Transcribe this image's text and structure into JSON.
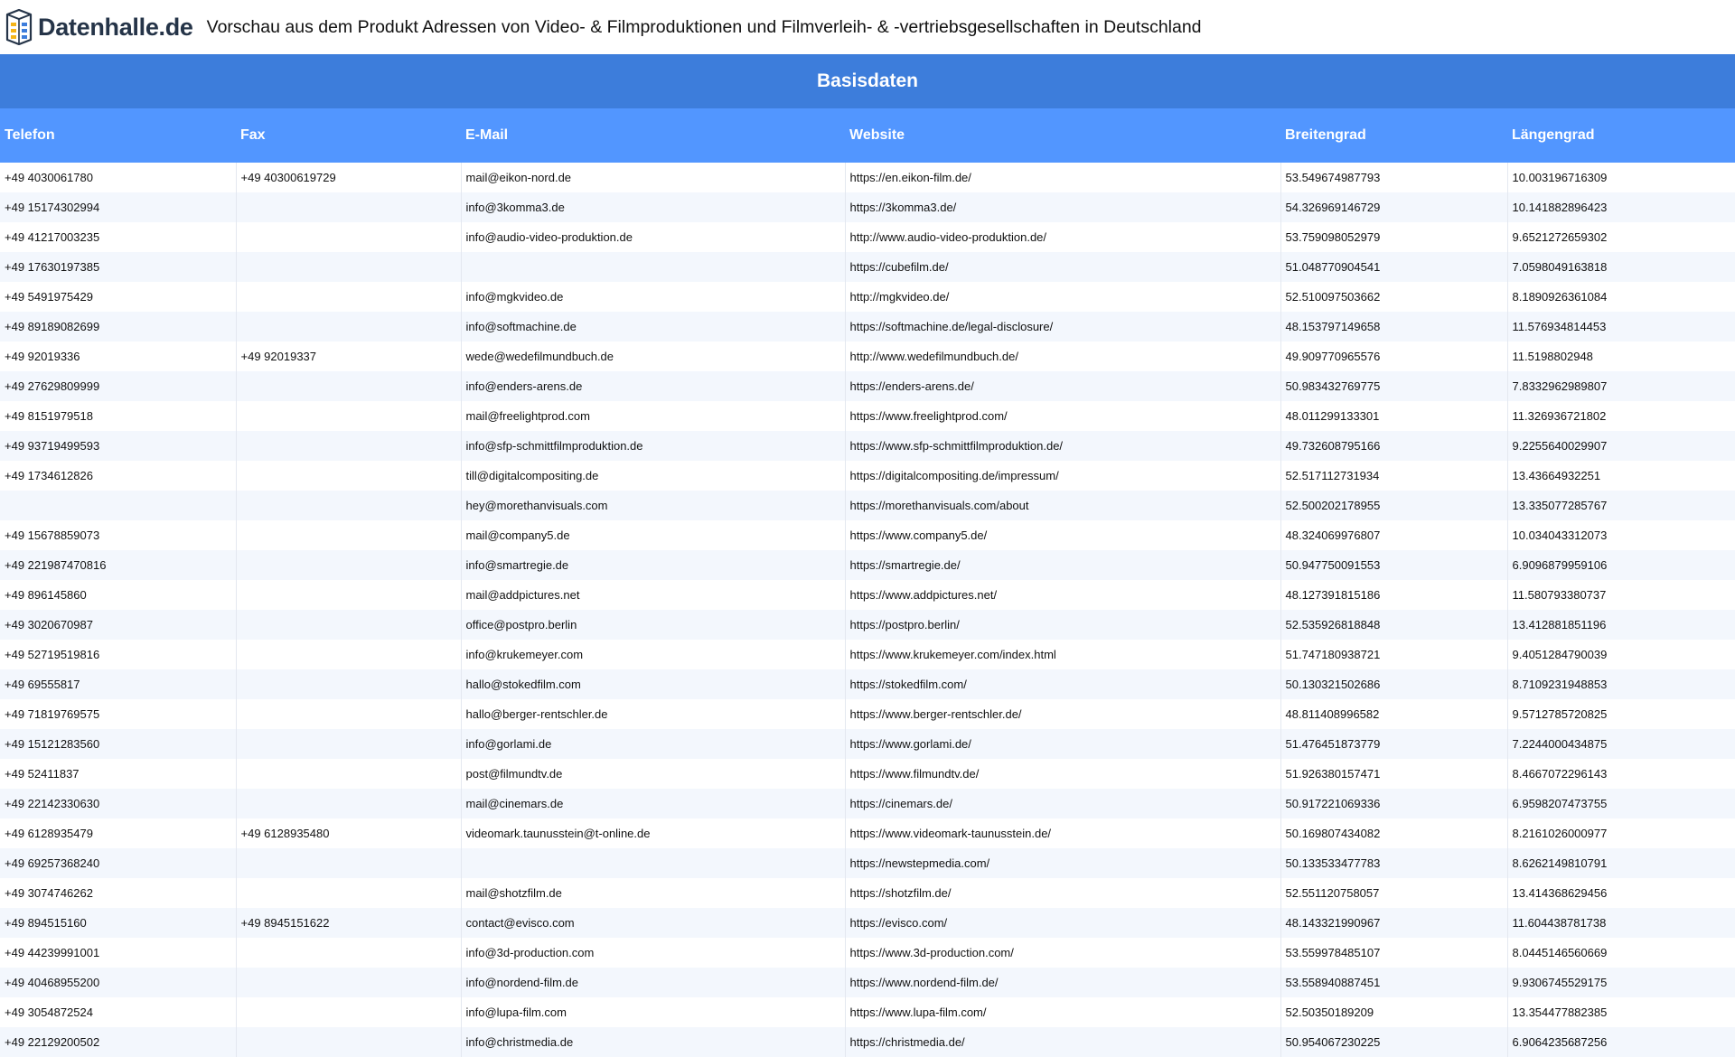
{
  "header": {
    "logo_text": "Datenhalle.de",
    "logo_icon": "database-icon",
    "page_title": "Vorschau aus dem Produkt Adressen von Video- & Filmproduktionen und Filmverleih- & -vertriebsgesellschaften in Deutschland"
  },
  "section": {
    "title": "Basisdaten"
  },
  "table": {
    "columns": [
      "Telefon",
      "Fax",
      "E-Mail",
      "Website",
      "Breitengrad",
      "Längengrad"
    ],
    "rows": [
      [
        "+49 4030061780",
        "+49 40300619729",
        "mail@eikon-nord.de",
        "https://en.eikon-film.de/",
        "53.549674987793",
        "10.003196716309"
      ],
      [
        "+49 15174302994",
        "",
        "info@3komma3.de",
        "https://3komma3.de/",
        "54.326969146729",
        "10.141882896423"
      ],
      [
        "+49 41217003235",
        "",
        "info@audio-video-produktion.de",
        "http://www.audio-video-produktion.de/",
        "53.759098052979",
        "9.6521272659302"
      ],
      [
        "+49 17630197385",
        "",
        "",
        "https://cubefilm.de/",
        "51.048770904541",
        "7.0598049163818"
      ],
      [
        "+49 5491975429",
        "",
        "info@mgkvideo.de",
        "http://mgkvideo.de/",
        "52.510097503662",
        "8.1890926361084"
      ],
      [
        "+49 89189082699",
        "",
        "info@softmachine.de",
        "https://softmachine.de/legal-disclosure/",
        "48.153797149658",
        "11.576934814453"
      ],
      [
        "+49 92019336",
        "+49 92019337",
        "wede@wedefilmundbuch.de",
        "http://www.wedefilmundbuch.de/",
        "49.909770965576",
        "11.5198802948"
      ],
      [
        "+49 27629809999",
        "",
        "info@enders-arens.de",
        "https://enders-arens.de/",
        "50.983432769775",
        "7.8332962989807"
      ],
      [
        "+49 8151979518",
        "",
        "mail@freelightprod.com",
        "https://www.freelightprod.com/",
        "48.011299133301",
        "11.326936721802"
      ],
      [
        "+49 93719499593",
        "",
        "info@sfp-schmittfilmproduktion.de",
        "https://www.sfp-schmittfilmproduktion.de/",
        "49.732608795166",
        "9.2255640029907"
      ],
      [
        "+49 1734612826",
        "",
        "till@digitalcompositing.de",
        "https://digitalcompositing.de/impressum/",
        "52.517112731934",
        "13.43664932251"
      ],
      [
        "",
        "",
        "hey@morethanvisuals.com",
        "https://morethanvisuals.com/about",
        "52.500202178955",
        "13.335077285767"
      ],
      [
        "+49 15678859073",
        "",
        "mail@company5.de",
        "https://www.company5.de/",
        "48.324069976807",
        "10.034043312073"
      ],
      [
        "+49 221987470816",
        "",
        "info@smartregie.de",
        "https://smartregie.de/",
        "50.947750091553",
        "6.9096879959106"
      ],
      [
        "+49 896145860",
        "",
        "mail@addpictures.net",
        "https://www.addpictures.net/",
        "48.127391815186",
        "11.580793380737"
      ],
      [
        "+49 3020670987",
        "",
        "office@postpro.berlin",
        "https://postpro.berlin/",
        "52.535926818848",
        "13.412881851196"
      ],
      [
        "+49 52719519816",
        "",
        "info@krukemeyer.com",
        "https://www.krukemeyer.com/index.html",
        "51.747180938721",
        "9.4051284790039"
      ],
      [
        "+49 69555817",
        "",
        "hallo@stokedfilm.com",
        "https://stokedfilm.com/",
        "50.130321502686",
        "8.7109231948853"
      ],
      [
        "+49 71819769575",
        "",
        "hallo@berger-rentschler.de",
        "https://www.berger-rentschler.de/",
        "48.811408996582",
        "9.5712785720825"
      ],
      [
        "+49 15121283560",
        "",
        "info@gorlami.de",
        "https://www.gorlami.de/",
        "51.476451873779",
        "7.2244000434875"
      ],
      [
        "+49 52411837",
        "",
        "post@filmundtv.de",
        "https://www.filmundtv.de/",
        "51.926380157471",
        "8.4667072296143"
      ],
      [
        "+49 22142330630",
        "",
        "mail@cinemars.de",
        "https://cinemars.de/",
        "50.917221069336",
        "6.9598207473755"
      ],
      [
        "+49 6128935479",
        "+49 6128935480",
        "videomark.taunusstein@t-online.de",
        "https://www.videomark-taunusstein.de/",
        "50.169807434082",
        "8.2161026000977"
      ],
      [
        "+49 69257368240",
        "",
        "",
        "https://newstepmedia.com/",
        "50.133533477783",
        "8.6262149810791"
      ],
      [
        "+49 3074746262",
        "",
        "mail@shotzfilm.de",
        "https://shotzfilm.de/",
        "52.551120758057",
        "13.414368629456"
      ],
      [
        "+49 894515160",
        "+49 8945151622",
        "contact@evisco.com",
        "https://evisco.com/",
        "48.143321990967",
        "11.604438781738"
      ],
      [
        "+49 44239991001",
        "",
        "info@3d-production.com",
        "https://www.3d-production.com/",
        "53.559978485107",
        "8.0445146560669"
      ],
      [
        "+49 40468955200",
        "",
        "info@nordend-film.de",
        "https://www.nordend-film.de/",
        "53.558940887451",
        "9.9306745529175"
      ],
      [
        "+49 3054872524",
        "",
        "info@lupa-film.com",
        "https://www.lupa-film.com/",
        "52.50350189209",
        "13.354477882385"
      ],
      [
        "+49 22129200502",
        "",
        "info@christmedia.de",
        "https://christmedia.de/",
        "50.954067230225",
        "6.9064235687256"
      ]
    ]
  },
  "colors": {
    "section_band": "#3d7ddb",
    "table_header": "#5296ff",
    "row_alt": "#f3f7fd",
    "logo_text": "#253448"
  }
}
